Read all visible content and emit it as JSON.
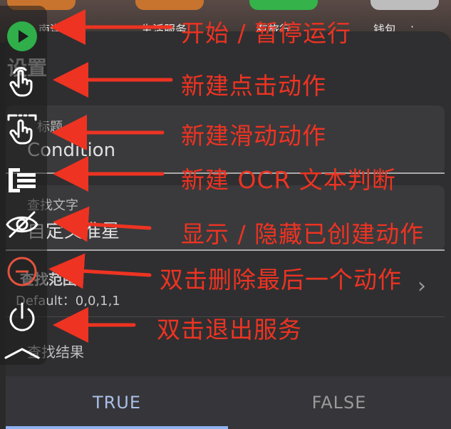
{
  "home": {
    "apps": [
      {
        "label": "",
        "color": "#c8742e"
      },
      {
        "label": "生活服务",
        "color": "#c8742e"
      },
      {
        "label": "",
        "color": "#35b24a"
      },
      {
        "label": "钱包",
        "color": "#bdbdbd"
      }
    ],
    "partial_label": "南洋",
    "partial_label2": "有旅行",
    "more": "·"
  },
  "settings": {
    "title": "设置",
    "title_field": {
      "label": "标题",
      "value": "Condition"
    },
    "search_text_field": {
      "label": "查找文字",
      "value": "自定义准星"
    },
    "search_range": {
      "label": "查找范围",
      "default": "Default：0,0,1,1"
    },
    "search_result": {
      "label": "查找结果"
    },
    "tabs": {
      "true_label": "TRUE",
      "false_label": "FALSE"
    }
  },
  "toolbar": {
    "accent": "#2fae4a",
    "items": [
      {
        "icon": "play-icon"
      },
      {
        "icon": "tap-gesture-icon"
      },
      {
        "icon": "swipe-gesture-icon"
      },
      {
        "icon": "list-text-icon"
      },
      {
        "icon": "eye-off-icon"
      },
      {
        "icon": "remove-icon"
      },
      {
        "icon": "power-icon"
      },
      {
        "icon": "chevron-up-icon"
      }
    ]
  },
  "annotations": {
    "color": "#ee3322",
    "captions": [
      "开始 / 暂停运行",
      "新建点击动作",
      "新建滑动动作",
      "新建 OCR 文本判断",
      "显示 / 隐藏已创建动作",
      "双击删除最后一个动作",
      "双击退出服务"
    ]
  }
}
